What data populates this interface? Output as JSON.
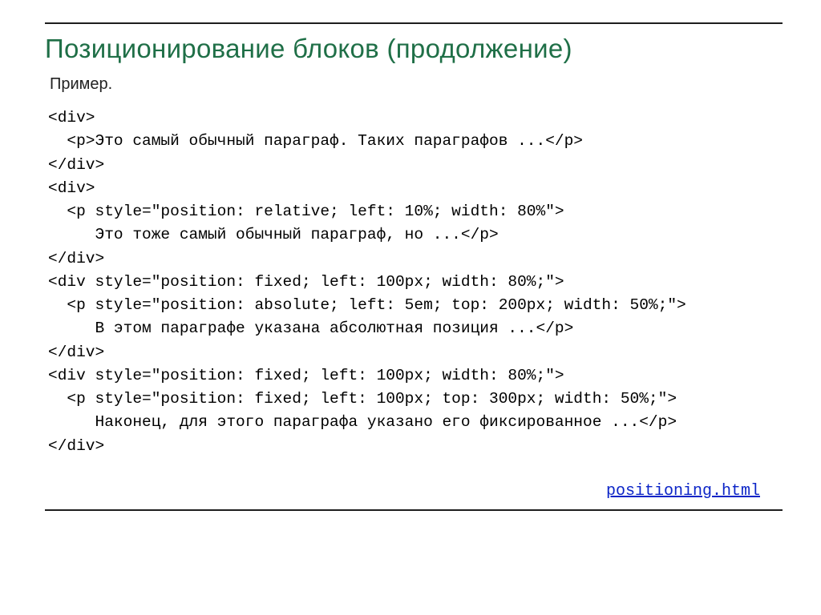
{
  "title": "Позиционирование блоков (продолжение)",
  "subheader": "Пример.",
  "code": "<div>\n  <p>Это самый обычный параграф. Таких параграфов ...</p>\n</div>\n<div>\n  <p style=\"position: relative; left: 10%; width: 80%\">\n     Это тоже самый обычный параграф, но ...</p>\n</div>\n<div style=\"position: fixed; left: 100px; width: 80%;\">\n  <p style=\"position: absolute; left: 5em; top: 200px; width: 50%;\">\n     В этом параграфе указана абсолютная позиция ...</p>\n</div>\n<div style=\"position: fixed; left: 100px; width: 80%;\">\n  <p style=\"position: fixed; left: 100px; top: 300px; width: 50%;\">\n     Наконец, для этого параграфа указано его фиксированное ...</p>\n</div>",
  "link_text": "positioning.html"
}
